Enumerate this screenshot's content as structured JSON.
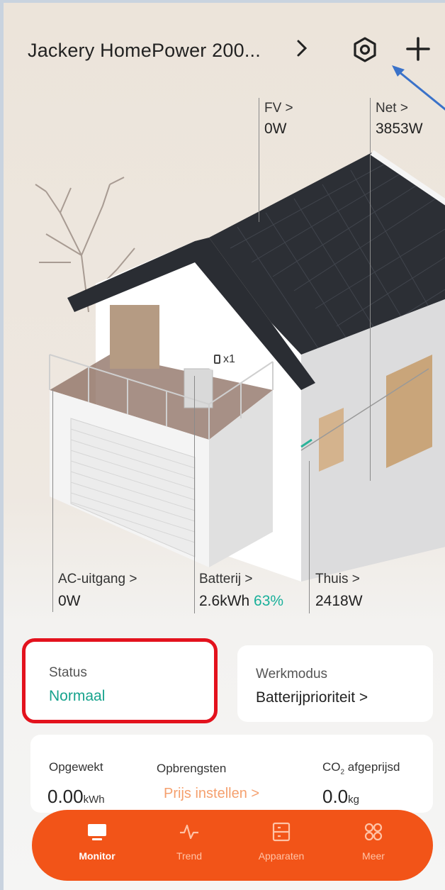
{
  "header": {
    "device_title": "Jackery HomePower 200...",
    "title_chevron": "›",
    "settings_icon": "settings-hex-icon",
    "add_icon": "plus-icon"
  },
  "energy": {
    "pv": {
      "label": "FV >",
      "value": "0W"
    },
    "grid": {
      "label": "Net >",
      "value": "3853W"
    },
    "ac_output": {
      "label": "AC-uitgang >",
      "value": "0W"
    },
    "battery": {
      "label": "Batterij >",
      "value": "2.6kWh",
      "percent": "63%",
      "count_badge": "x1"
    },
    "home": {
      "label": "Thuis >",
      "value": "2418W"
    }
  },
  "cards": {
    "status": {
      "label": "Status",
      "value": "Normaal"
    },
    "workmode": {
      "label": "Werkmodus",
      "value": "Batterijprioriteit >"
    }
  },
  "stats": {
    "generated": {
      "label": "Opgewekt",
      "value": "0.00",
      "unit": "kWh"
    },
    "revenue": {
      "label": "Opbrengsten",
      "link": "Prijs instellen >"
    },
    "co2": {
      "label_prefix": "CO",
      "label_sub": "2",
      "label_suffix": " afgeprijsd",
      "value": "0.0",
      "unit": "kg"
    }
  },
  "nav": {
    "items": [
      {
        "label": "Monitor",
        "icon": "monitor-icon",
        "active": true
      },
      {
        "label": "Trend",
        "icon": "trend-icon",
        "active": false
      },
      {
        "label": "Apparaten",
        "icon": "devices-icon",
        "active": false
      },
      {
        "label": "Meer",
        "icon": "more-icon",
        "active": false
      }
    ]
  },
  "colors": {
    "accent_orange": "#f25418",
    "status_green": "#17a38d",
    "highlight_red": "#e3121d",
    "annotation_blue": "#3a72c9"
  }
}
